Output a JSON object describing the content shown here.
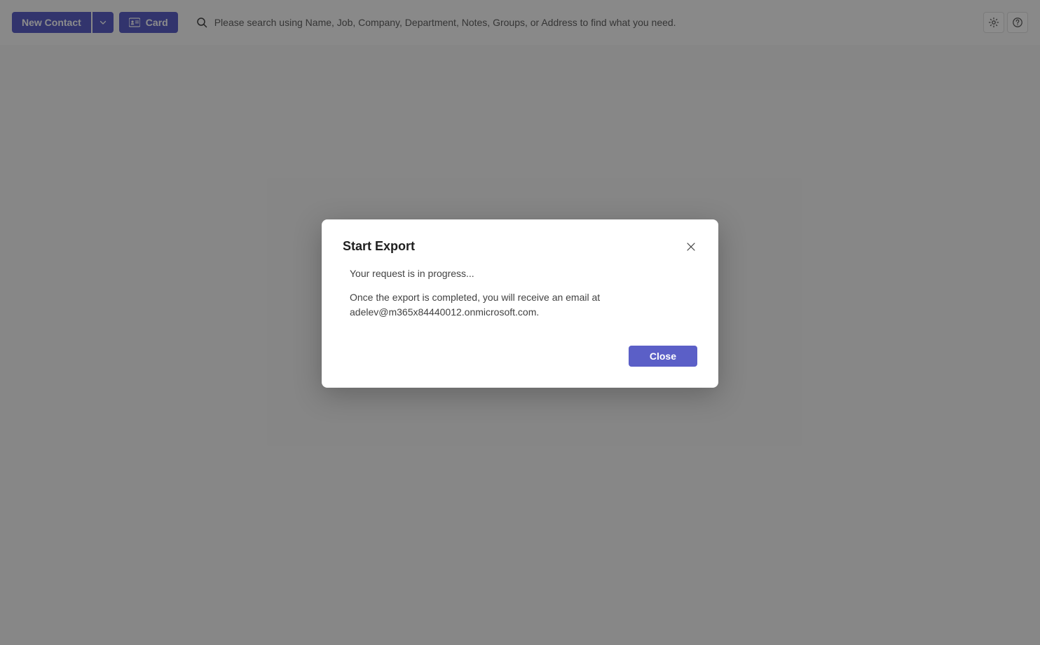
{
  "toolbar": {
    "new_contact_label": "New Contact",
    "card_label": "Card",
    "search_placeholder": "Please search using Name, Job, Company, Department, Notes, Groups, or Address to find what you need."
  },
  "dialog": {
    "title": "Start Export",
    "progress_text": "Your request is in progress...",
    "completion_text": "Once the export is completed, you will receive an email at adelev@m365x84440012.onmicrosoft.com.",
    "close_label": "Close"
  }
}
